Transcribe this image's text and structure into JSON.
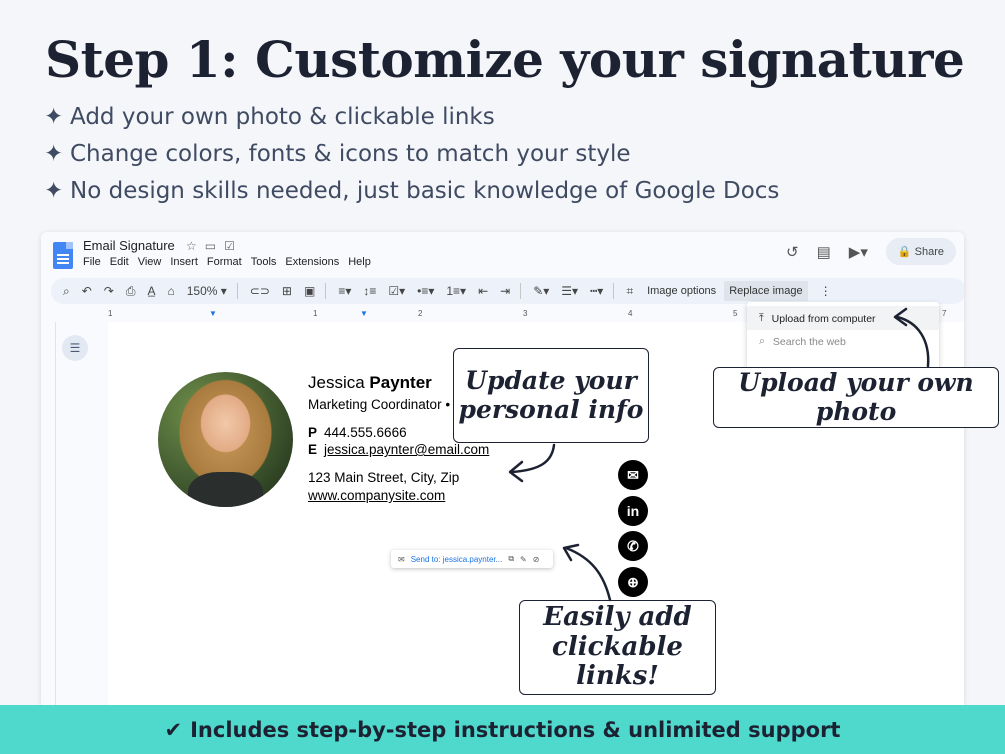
{
  "hero": {
    "title": "Step 1: Customize your signature",
    "bullets": [
      "Add your own photo & clickable links",
      "Change colors, fonts & icons to match your style",
      "No design skills needed, just basic knowledge of Google Docs"
    ]
  },
  "doc": {
    "title": "Email Signature",
    "menu": [
      "File",
      "Edit",
      "View",
      "Insert",
      "Format",
      "Tools",
      "Extensions",
      "Help"
    ],
    "share_label": "Share",
    "zoom": "150%",
    "image_options_label": "Image options",
    "replace_image_label": "Replace image",
    "replace_menu": {
      "upload": "Upload from computer",
      "search": "Search the web"
    },
    "ruler_marks": [
      "1",
      "1",
      "1",
      "2",
      "3",
      "4",
      "5",
      "6",
      "7"
    ]
  },
  "signature": {
    "first_name": "Jessica",
    "last_name": "Paynter",
    "role": "Marketing Coordinator • Maple Group",
    "phone_label": "P",
    "phone": "444.555.6666",
    "email_label": "E",
    "email": "jessica.paynter@email.com",
    "address": "123 Main Street, City, Zip",
    "website": "www.companysite.com",
    "link_chip": "Send to: jessica.paynter..."
  },
  "social_icons": [
    "email-icon",
    "linkedin-icon",
    "whatsapp-icon",
    "globe-icon"
  ],
  "callouts": {
    "personal": "Update your personal info",
    "photo": "Upload your own photo",
    "links": "Easily add clickable links!"
  },
  "footer": {
    "text": "Includes step-by-step instructions & unlimited support"
  },
  "colors": {
    "headline": "#1d2233",
    "footer_bg": "#4fd9cd",
    "docs_blue": "#4285f4",
    "link_blue": "#1a73e8"
  }
}
